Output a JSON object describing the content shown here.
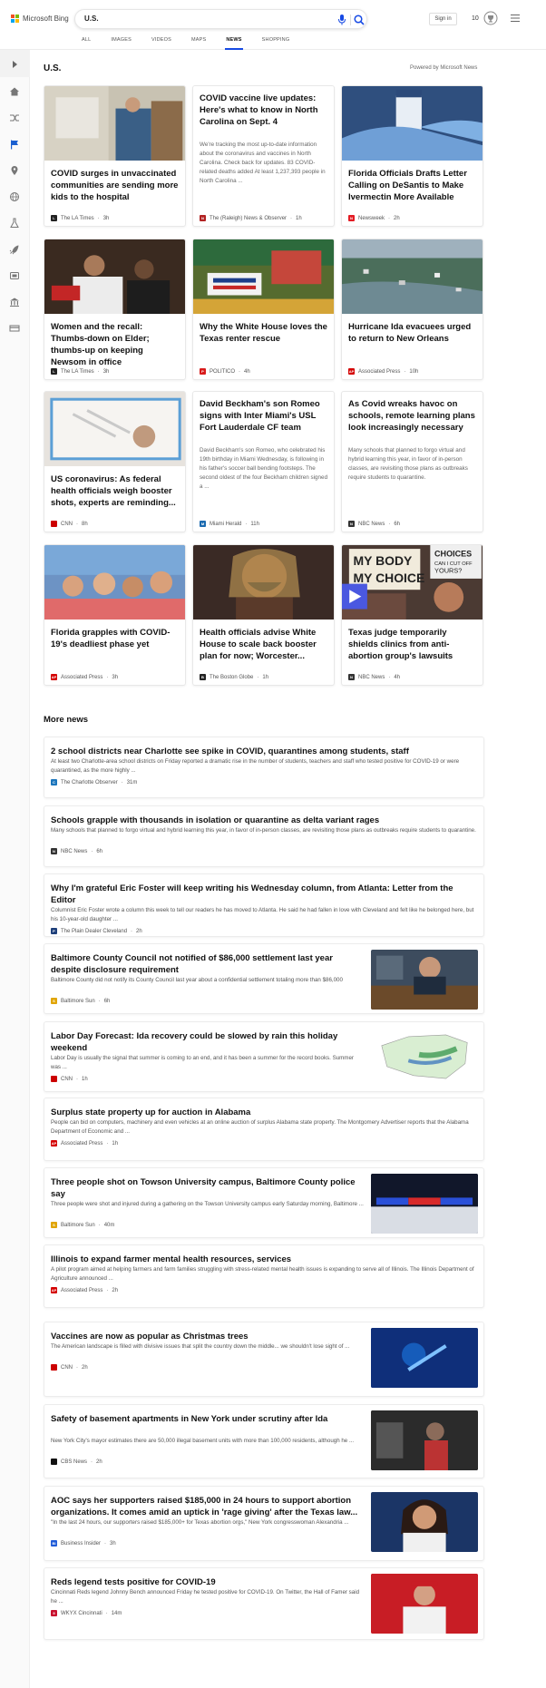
{
  "header": {
    "brand": "Microsoft Bing",
    "search_query": "U.S.",
    "sign_in": "Sign in",
    "rewards_count": "10",
    "colors": {
      "accent": "#174ae4",
      "logo": [
        "#f25022",
        "#7fba00",
        "#00a4ef",
        "#ffb900"
      ]
    },
    "tabs": [
      {
        "label": "ALL"
      },
      {
        "label": "IMAGES"
      },
      {
        "label": "VIDEOS"
      },
      {
        "label": "MAPS"
      },
      {
        "label": "NEWS"
      },
      {
        "label": "SHOPPING"
      }
    ],
    "active_tab": "NEWS"
  },
  "sidebar": {
    "icons": [
      "expand-arrow-icon",
      "home-icon",
      "shuffle-icon",
      "flag-icon",
      "location-pin-icon",
      "globe-icon",
      "science-icon",
      "rocket-icon",
      "entertainment-icon",
      "bank-icon",
      "money-icon"
    ]
  },
  "section": {
    "title": "U.S.",
    "powered_by": "Powered by Microsoft News"
  },
  "cards": [
    {
      "title": "COVID surges in unvaccinated communities are sending more kids to the hospital",
      "source": "The LA Times",
      "age": "3h",
      "has_image": true,
      "favicon_color": "#222222",
      "favicon_letter": "L",
      "image": "hospital"
    },
    {
      "title": "COVID vaccine live updates: Here's what to know in North Carolina on Sept. 4",
      "snippet": "We're tracking the most up-to-date information about the coronavirus and vaccines in North Carolina. Check back for updates. 83 COVID-related deaths added At least 1,237,393 people in North Carolina ...",
      "source": "The (Raleigh) News & Observer",
      "age": "1h",
      "has_image": false,
      "favicon_color": "#b22222",
      "favicon_letter": "N"
    },
    {
      "title": "Florida Officials Drafts Letter Calling on DeSantis to Make Ivermectin More Available",
      "source": "Newsweek",
      "age": "2h",
      "has_image": true,
      "favicon_color": "#e31b23",
      "favicon_letter": "N",
      "image": "vial"
    },
    {
      "title": "Women and the recall: Thumbs-down on Elder; thumbs-up on keeping Newsom in office",
      "source": "The LA Times",
      "age": "3h",
      "has_image": true,
      "favicon_color": "#222222",
      "favicon_letter": "L",
      "image": "rally"
    },
    {
      "title": "Why the White House loves the Texas renter rescue",
      "source": "POLITICO",
      "age": "4h",
      "has_image": true,
      "favicon_color": "#d81b1b",
      "favicon_letter": "P",
      "image": "protest"
    },
    {
      "title": "Hurricane Ida evacuees urged to return to New Orleans",
      "source": "Associated Press",
      "age": "10h",
      "has_image": true,
      "favicon_color": "#d40000",
      "favicon_letter": "AP",
      "image": "flood"
    },
    {
      "title": "US coronavirus: As federal health officials weigh booster shots, experts are reminding...",
      "source": "CNN",
      "age": "8h",
      "has_image": true,
      "favicon_color": "#cc0000",
      "favicon_letter": "CNN",
      "image": "syringes"
    },
    {
      "title": "David Beckham's son Romeo signs with Inter Miami's USL Fort Lauderdale CF team",
      "snippet": "David Beckham's son Romeo, who celebrated his 19th birthday in Miami Wednesday, is following in his father's soccer ball bending footsteps. The second oldest of the four Beckham children signed a ...",
      "source": "Miami Herald",
      "age": "11h",
      "has_image": false,
      "favicon_color": "#1c6bb0",
      "favicon_letter": "M"
    },
    {
      "title": "As Covid wreaks havoc on schools, remote learning plans look increasingly necessary",
      "snippet": "Many schools that planned to forgo virtual and hybrid learning this year, in favor of in-person classes, are revisiting those plans as outbreaks require students to quarantine.",
      "source": "NBC News",
      "age": "6h",
      "has_image": false,
      "favicon_color": "#333333",
      "favicon_letter": "N"
    },
    {
      "title": "Florida grapples with COVID-19's deadliest phase yet",
      "source": "Associated Press",
      "age": "3h",
      "has_image": true,
      "favicon_color": "#d40000",
      "favicon_letter": "AP",
      "image": "family"
    },
    {
      "title": "Health officials advise White House to scale back booster plan for now; Worcester...",
      "source": "The Boston Globe",
      "age": "1h",
      "has_image": true,
      "favicon_color": "#222222",
      "favicon_letter": "B",
      "image": "mask"
    },
    {
      "title": "Texas judge temporarily shields clinics from anti-abortion group's lawsuits",
      "source": "NBC News",
      "age": "4h",
      "has_image": true,
      "favicon_color": "#333333",
      "favicon_letter": "N",
      "image": "sign",
      "is_video": true,
      "sign_text": [
        "MY BODY",
        "MY CHOICE"
      ],
      "sign_text_2": [
        "CHOICES",
        "CAN I CUT OFF",
        "YOURS?"
      ]
    }
  ],
  "more_news": {
    "title": "More news",
    "items": [
      {
        "title": "2 school districts near Charlotte see spike in COVID, quarantines among students, staff",
        "snippet": "At least two Charlotte-area school districts on Friday reported a dramatic rise in the number of students, teachers and staff who tested positive for COVID-19 or were quarantined, as the more highly ...",
        "source": "The Charlotte Observer",
        "age": "31m",
        "favicon_color": "#1a75bc",
        "favicon_letter": "C",
        "image": null
      },
      {
        "title": "Schools grapple with thousands in isolation or quarantine as delta variant rages",
        "snippet": "Many schools that planned to forgo virtual and hybrid learning this year, in favor of in-person classes, are revisiting those plans as outbreaks require students to quarantine.",
        "source": "NBC News",
        "age": "6h",
        "favicon_color": "#333333",
        "favicon_letter": "N",
        "image": null
      },
      {
        "title": "Why I'm grateful Eric Foster will keep writing his Wednesday column, from Atlanta: Letter from the Editor",
        "snippet": "Columnist Eric Foster wrote a column this week to tell our readers he has moved to Atlanta. He said he had fallen in love with Cleveland and felt like he belonged here, but his 10-year-old daughter ...",
        "source": "The Plain Dealer Cleveland",
        "age": "2h",
        "favicon_color": "#1e3f7a",
        "favicon_letter": "P",
        "image": null
      },
      {
        "title": "Baltimore County Council not notified of $86,000 settlement last year despite disclosure requirement",
        "snippet": "Baltimore County did not notify its County Council last year about a confidential settlement totaling more than $86,000",
        "source": "Baltimore Sun",
        "age": "6h",
        "favicon_color": "#e0a400",
        "favicon_letter": "S",
        "image": "council"
      },
      {
        "title": "Labor Day Forecast: Ida recovery could be slowed by rain this holiday weekend",
        "snippet": "Labor Day is usually the signal that summer is coming to an end, and it has been a summer for the record books. Summer was ...",
        "source": "CNN",
        "age": "1h",
        "favicon_color": "#cc0000",
        "favicon_letter": "CNN",
        "image": "map"
      },
      {
        "title": "Surplus state property up for auction in Alabama",
        "snippet": "People can bid on computers, machinery and even vehicles at an online auction of surplus Alabama state property. The Montgomery Advertiser reports that the Alabama Department of Economic and ...",
        "source": "Associated Press",
        "age": "1h",
        "favicon_color": "#d40000",
        "favicon_letter": "AP",
        "image": null
      },
      {
        "title": "Three people shot on Towson University campus, Baltimore County police say",
        "snippet": "Three people were shot and injured during a gathering on the Towson University campus early Saturday morning, Baltimore ...",
        "source": "Baltimore Sun",
        "age": "40m",
        "favicon_color": "#e0a400",
        "favicon_letter": "S",
        "image": "police"
      },
      {
        "title": "Illinois to expand farmer mental health resources, services",
        "snippet": "A pilot program aimed at helping farmers and farm families struggling with stress-related mental health issues is expanding to serve all of Illinois. The Illinois Department of Agriculture announced ...",
        "source": "Associated Press",
        "age": "2h",
        "favicon_color": "#d40000",
        "favicon_letter": "AP",
        "image": null
      },
      {
        "title": "Vaccines are now as popular as Christmas trees",
        "snippet": "The American landscape is filled with divisive issues that split the country down the middle... we shouldn't lose sight of ...",
        "source": "CNN",
        "age": "2h",
        "favicon_color": "#cc0000",
        "favicon_letter": "CNN",
        "image": "vaccine"
      },
      {
        "title": "Safety of basement apartments in New York under scrutiny after Ida",
        "snippet": "New York City's mayor estimates there are 50,000 illegal basement units with more than 100,000 residents, although he ...",
        "source": "CBS News",
        "age": "2h",
        "favicon_color": "#111111",
        "favicon_letter": "CBS",
        "image": "basement"
      },
      {
        "title": "AOC says her supporters raised $185,000 in 24 hours to support abortion organizations. It comes amid an uptick in 'rage giving' after the Texas law...",
        "snippet": "\"In the last 24 hours, our supporters raised $185,000+ for Texas abortion orgs,\" New York congresswoman Alexandria ...",
        "source": "Business Insider",
        "age": "3h",
        "favicon_color": "#1f5bd8",
        "favicon_letter": "BI",
        "image": "aoc"
      },
      {
        "title": "Reds legend tests positive for COVID-19",
        "snippet": "Cincinnati Reds legend Johnny Bench announced Friday he tested positive for COVID-19. On Twitter, the Hall of Famer said he ...",
        "source": "WKYX Cincinnati",
        "age": "14m",
        "favicon_color": "#c8102e",
        "favicon_letter": "9",
        "image": "reds"
      }
    ]
  }
}
